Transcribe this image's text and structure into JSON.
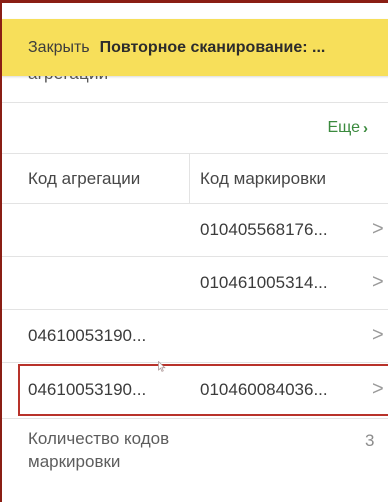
{
  "topbar": {
    "close_label": "Закрыть",
    "title": "Повторное сканирование: ..."
  },
  "partial_label": "агрегации",
  "more": {
    "label": "Еще",
    "chevron": "›"
  },
  "table": {
    "headers": [
      "Код агрегации",
      "Код маркировки"
    ],
    "rows": [
      {
        "aggregation": "",
        "marking": "010405568176...",
        "arrow": ">"
      },
      {
        "aggregation": "",
        "marking": "010461005314...",
        "arrow": ">"
      },
      {
        "aggregation": "04610053190...",
        "marking": "",
        "arrow": ">"
      },
      {
        "aggregation": "04610053190...",
        "marking": "010460084036...",
        "arrow": ">",
        "selected": true
      }
    ]
  },
  "summary": {
    "label": "Количество кодов маркировки",
    "value": "3"
  },
  "colors": {
    "topbar_bg": "#f7df5a",
    "more_link": "#3b8a3e",
    "selection_border": "#b8322a",
    "frame_border": "#8a1e14"
  },
  "icons": [
    "chevron-right-icon",
    "mouse-cursor-icon"
  ]
}
